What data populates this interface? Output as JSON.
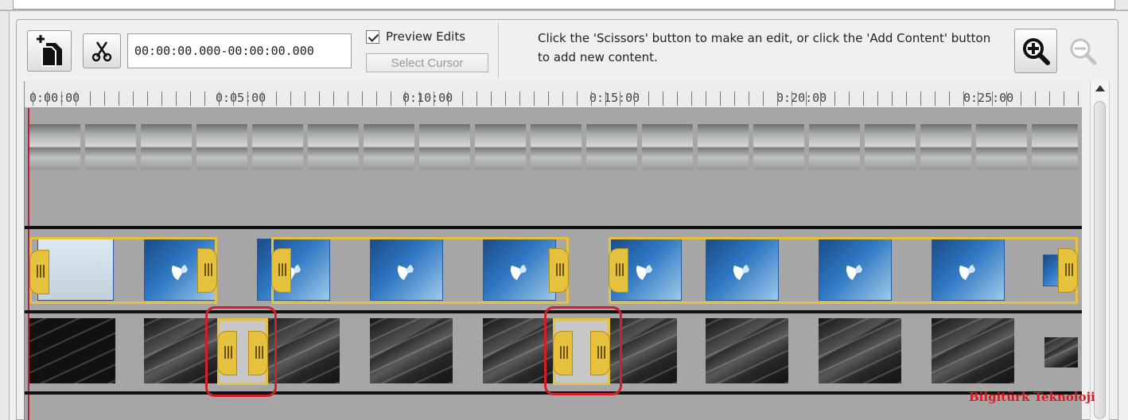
{
  "toolbar": {
    "timecode": "00:00:00.000-00:00:00.000",
    "preview_label": "Preview Edits",
    "preview_checked": true,
    "select_cursor_label": "Select Cursor",
    "hint": "Click the 'Scissors' button to make an edit, or click the 'Add Content' button to add new content."
  },
  "ruler": {
    "labels": [
      "0:00:00",
      "0:05:00",
      "0:10:00",
      "0:15:00",
      "0:20:00",
      "0:25:00"
    ]
  },
  "watermark": "Bilgitürk Teknoloji",
  "icons": [
    "add-content-icon",
    "scissors-icon",
    "zoom-in-icon",
    "zoom-out-icon",
    "scroll-up-arrow-icon"
  ]
}
